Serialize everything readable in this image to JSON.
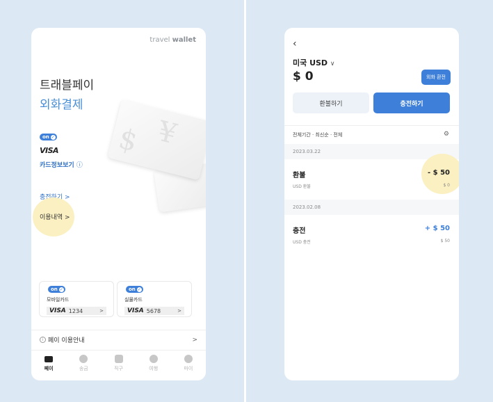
{
  "left_screen": {
    "brand": {
      "light": "travel ",
      "bold": "wallet"
    },
    "title_line1": "트래블페이",
    "title_line2": "외화결제",
    "toggle_label": "on",
    "card_brand": "VISA",
    "card_info_link": "카드정보보기",
    "charge_link": "충전하기 >",
    "history_link": "이용내역 >",
    "mini_cards": [
      {
        "label": "모바일카드",
        "brand": "VISA",
        "number": "1234",
        "chevron": ">"
      },
      {
        "label": "실물카드",
        "brand": "VISA",
        "number": "5678",
        "chevron": ">"
      }
    ],
    "pay_guide": "페이 이용안내",
    "pay_guide_chevron": ">",
    "tabs": [
      {
        "label": "페이",
        "icon": "card-icon",
        "active": true
      },
      {
        "label": "송금",
        "icon": "coin-icon",
        "active": false
      },
      {
        "label": "직구",
        "icon": "bag-icon",
        "active": false
      },
      {
        "label": "여행",
        "icon": "plane-icon",
        "active": false
      },
      {
        "label": "마이",
        "icon": "person-icon",
        "active": false
      }
    ]
  },
  "right_screen": {
    "currency": "미국 USD",
    "balance": "$ 0",
    "fx_button": "외화 환전",
    "refund_button": "환불하기",
    "charge_button": "충전하기",
    "filter_text": "전체기간 · 최신순 · 전체",
    "transactions": [
      {
        "date": "2023.03.22",
        "title": "환불",
        "subtitle": "USD 환불",
        "amount": "- $ 50",
        "sub_amount": "$ 0"
      },
      {
        "date": "2023.02.08",
        "title": "충전",
        "subtitle": "USD 충전",
        "amount": "+ $ 50",
        "sub_amount": "$ 50"
      }
    ]
  },
  "colors": {
    "background": "#dce9f5",
    "accent": "#3d7fd9",
    "highlight": "#fbf0c2"
  }
}
